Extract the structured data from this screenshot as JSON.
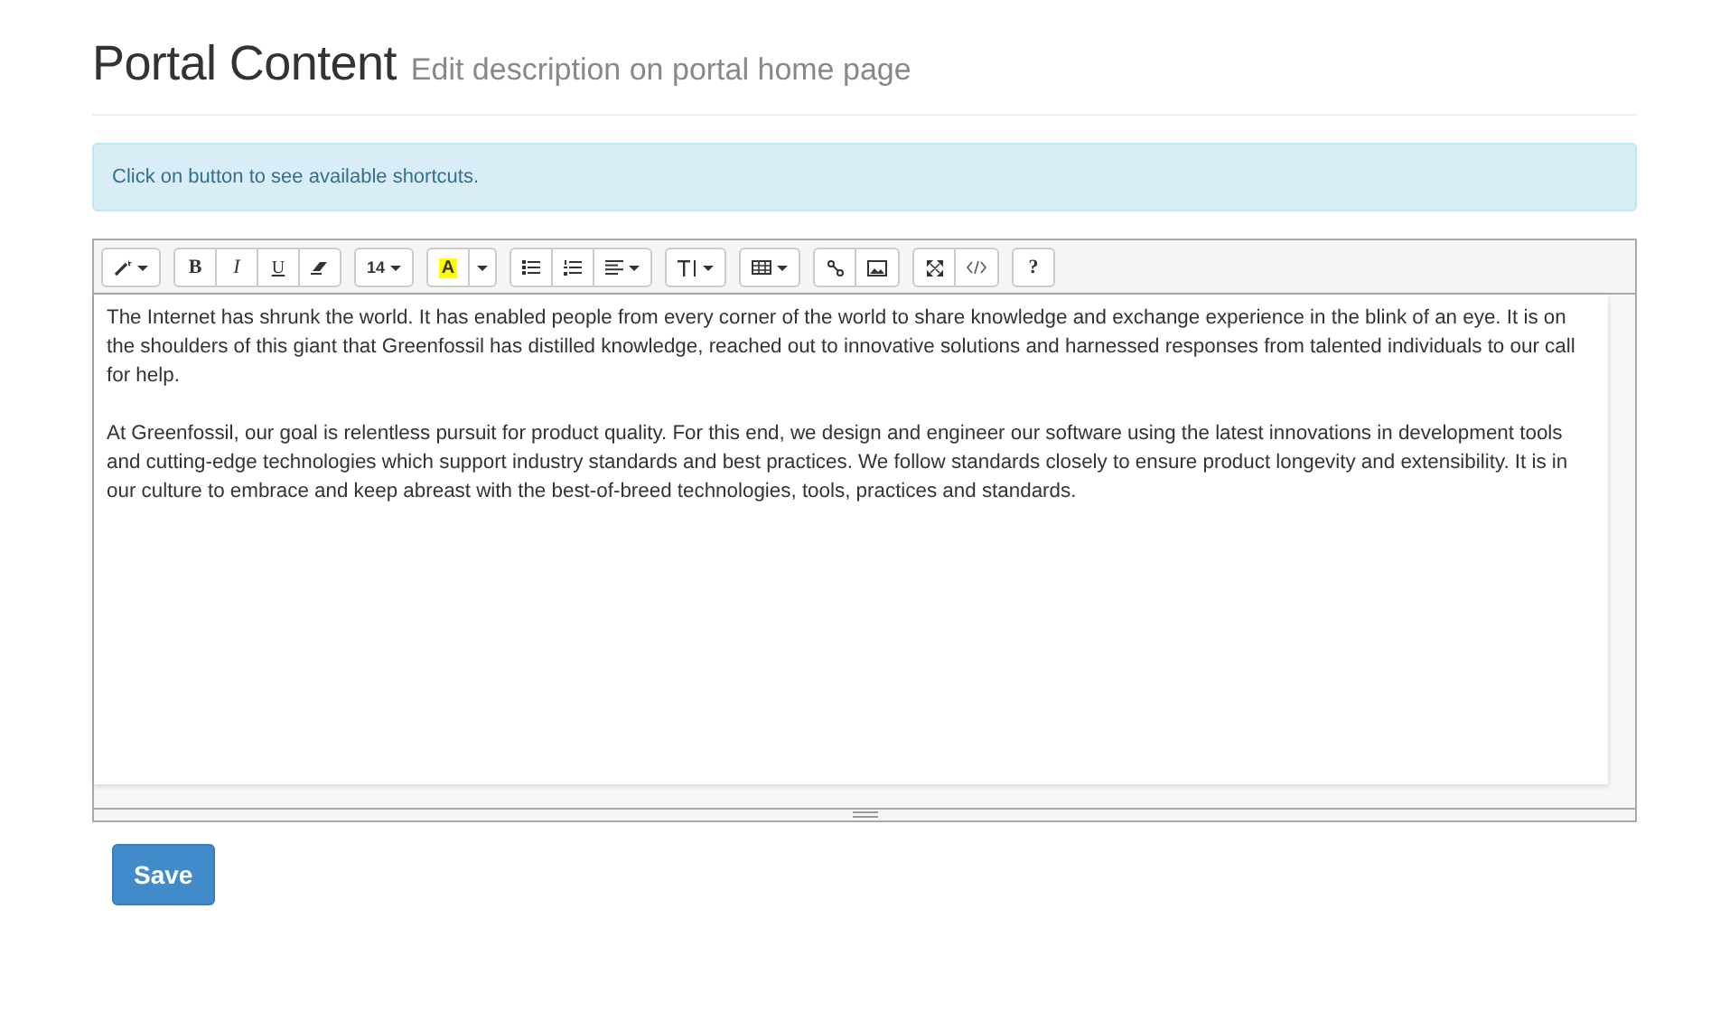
{
  "header": {
    "title": "Portal Content",
    "subtitle": "Edit description on portal home page"
  },
  "alert": {
    "text": "Click on button to see available shortcuts."
  },
  "toolbar": [
    [
      {
        "kind": "magic",
        "caret": true
      }
    ],
    [
      {
        "kind": "text",
        "label": "B",
        "caret": false
      },
      {
        "kind": "text",
        "label": "I",
        "caret": false
      },
      {
        "kind": "text",
        "label": "U",
        "caret": false
      },
      {
        "kind": "eraser",
        "caret": false
      }
    ],
    [
      {
        "kind": "text",
        "label": "14",
        "caret": true
      }
    ],
    [
      {
        "kind": "color",
        "label": "A",
        "caret": false
      },
      {
        "kind": "caret",
        "caret": true
      }
    ],
    [
      {
        "kind": "ul",
        "caret": false
      },
      {
        "kind": "ol",
        "caret": false
      },
      {
        "kind": "align",
        "caret": true
      }
    ],
    [
      {
        "kind": "height",
        "caret": true
      }
    ],
    [
      {
        "kind": "table",
        "caret": true
      }
    ],
    [
      {
        "kind": "link",
        "caret": false
      },
      {
        "kind": "image",
        "caret": false
      }
    ],
    [
      {
        "kind": "fullscreen",
        "caret": false
      },
      {
        "kind": "code",
        "caret": false
      }
    ],
    [
      {
        "kind": "text",
        "label": "?",
        "caret": false
      }
    ]
  ],
  "content": [
    "The Internet has shrunk the world. It has enabled people from every corner of the world to share knowledge and exchange experience in the blink of an eye. It is on the shoulders of this giant that Greenfossil has distilled knowledge, reached out to innovative solutions and harnessed responses from talented individuals to our call for help.",
    "At Greenfossil, our goal is relentless pursuit for product quality. For this end, we design and engineer our software using the latest innovations in development tools and cutting-edge technologies which support industry standards and best practices. We follow standards closely to ensure product longevity and extensibility. It is in our culture to embrace and keep abreast with the best-of-breed technologies, tools, practices and standards."
  ],
  "save_button": {
    "label": "Save"
  }
}
